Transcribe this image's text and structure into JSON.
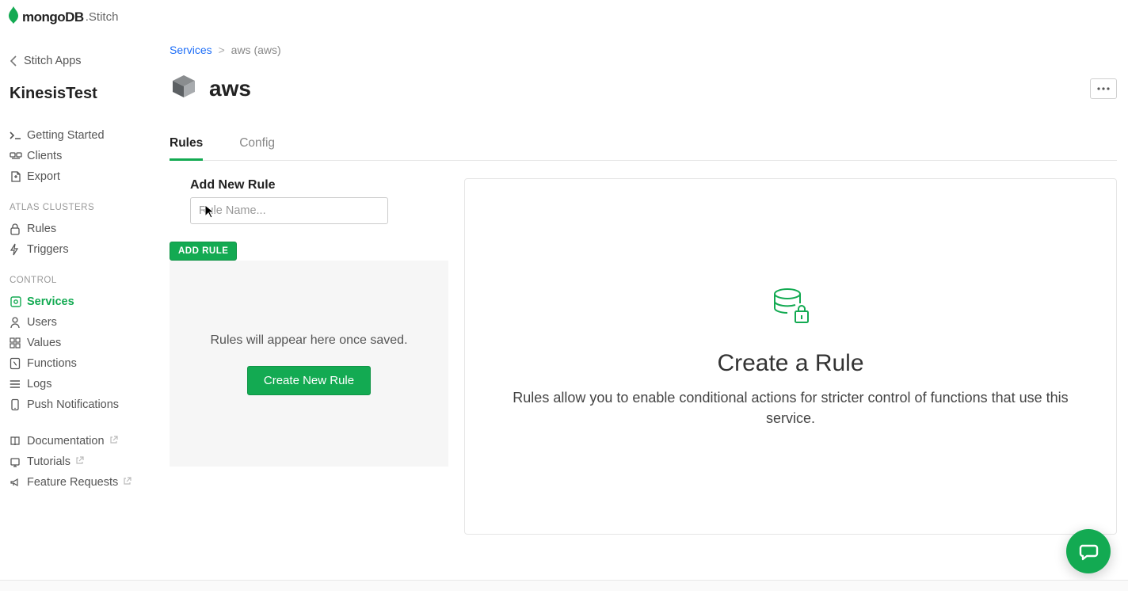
{
  "brand": {
    "name": "mongoDB",
    "suffix": "Stitch"
  },
  "sidebar": {
    "back_label": "Stitch Apps",
    "app_name": "KinesisTest",
    "top_items": [
      {
        "label": "Getting Started"
      },
      {
        "label": "Clients"
      },
      {
        "label": "Export"
      }
    ],
    "sections": [
      {
        "title": "ATLAS CLUSTERS",
        "items": [
          {
            "label": "Rules"
          },
          {
            "label": "Triggers"
          }
        ]
      },
      {
        "title": "CONTROL",
        "items": [
          {
            "label": "Services",
            "active": true
          },
          {
            "label": "Users"
          },
          {
            "label": "Values"
          },
          {
            "label": "Functions"
          },
          {
            "label": "Logs"
          },
          {
            "label": "Push Notifications"
          }
        ]
      }
    ],
    "footer_items": [
      {
        "label": "Documentation"
      },
      {
        "label": "Tutorials"
      },
      {
        "label": "Feature Requests"
      }
    ]
  },
  "breadcrumb": {
    "root": "Services",
    "current": "aws (aws)"
  },
  "page": {
    "title": "aws",
    "tabs": [
      {
        "label": "Rules",
        "active": true
      },
      {
        "label": "Config"
      }
    ],
    "add_rule_heading": "Add New Rule",
    "rule_name_placeholder": "Rule Name...",
    "add_rule_chip": "ADD RULE",
    "placeholder_text": "Rules will appear here once saved.",
    "create_rule_button": "Create New Rule",
    "right_heading": "Create a Rule",
    "right_text": "Rules allow you to enable conditional actions for stricter control of functions that use this service."
  }
}
